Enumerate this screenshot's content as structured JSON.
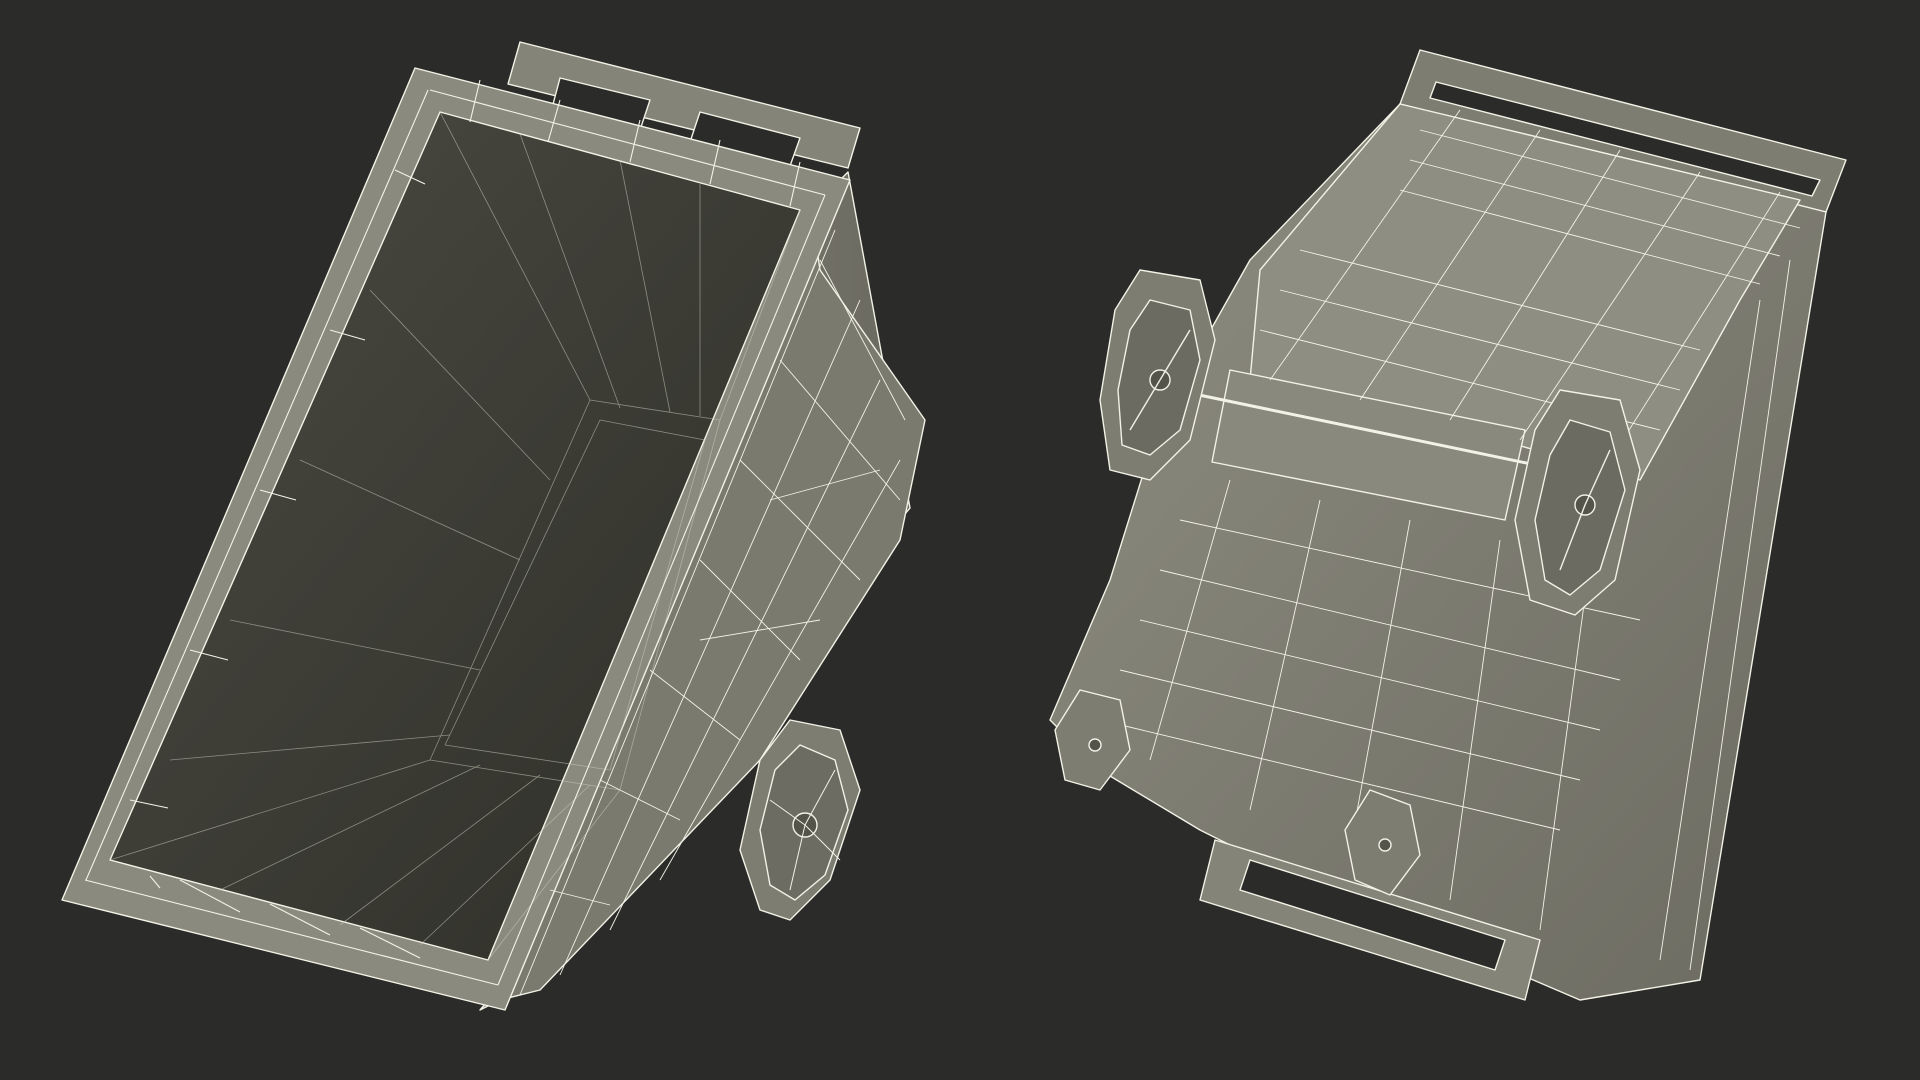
{
  "scene": {
    "background": "#2b2b29",
    "surface_color": "#807f74",
    "surface_light": "#9a998d",
    "surface_dark": "#5f5e55",
    "interior_color": "#3a3a33",
    "wire_color": "#f2f2e6",
    "objects": [
      {
        "name": "cart-view-open-top",
        "wheels": 1
      },
      {
        "name": "cart-view-underside",
        "wheels": 4
      }
    ]
  }
}
